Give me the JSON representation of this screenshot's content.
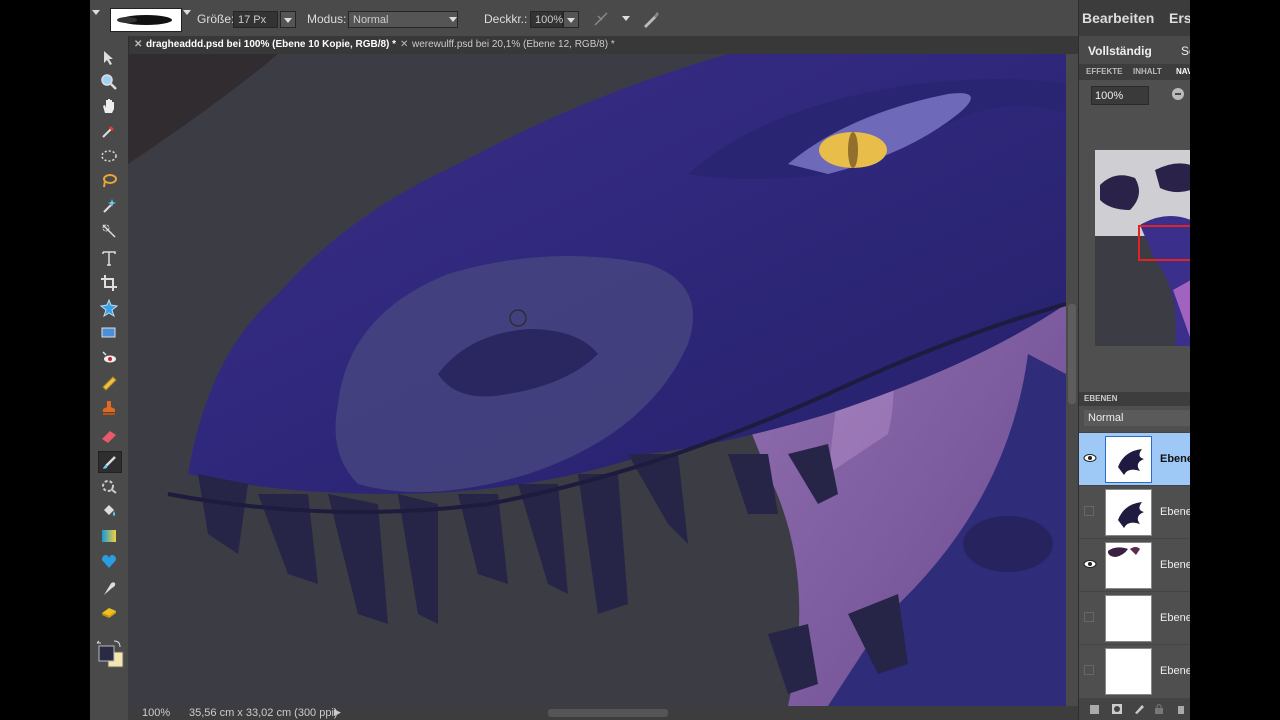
{
  "options_bar": {
    "size_label": "Größe:",
    "size_value": "17 Px",
    "mode_label": "Modus:",
    "mode_value": "Normal",
    "opacity_label": "Deckkr.:",
    "opacity_value": "100%"
  },
  "tabs": [
    {
      "label": "dragheaddd.psd bei 100% (Ebene 10 Kopie, RGB/8) *",
      "active": true
    },
    {
      "label": "werewulff.psd bei 20,1% (Ebene 12, RGB/8) *",
      "active": false
    }
  ],
  "status": {
    "zoom": "100%",
    "doc_info": "35,56 cm x 33,02 cm (300 ppi)"
  },
  "panel": {
    "main_tab": "Bearbeiten",
    "second_tab": "Ers",
    "sub_tab_full": "Vollständig",
    "sub_tab_other": "Sc",
    "panel_tabs": [
      "EFFEKTE",
      "INHALT",
      "NAV"
    ],
    "nav_zoom": "100%",
    "layers_title": "EBENEN",
    "blend_mode": "Normal",
    "layers": [
      {
        "name": "Ebene",
        "visible": true,
        "selected": true
      },
      {
        "name": "Ebene",
        "visible": false,
        "selected": false
      },
      {
        "name": "Ebene",
        "visible": true,
        "selected": false
      },
      {
        "name": "Ebene",
        "visible": false,
        "selected": false
      },
      {
        "name": "Ebene",
        "visible": false,
        "selected": false
      }
    ]
  },
  "colors": {
    "foreground": "#2b2a45",
    "background": "#f5e6b0",
    "selected_layer": "#9ec8f5"
  }
}
